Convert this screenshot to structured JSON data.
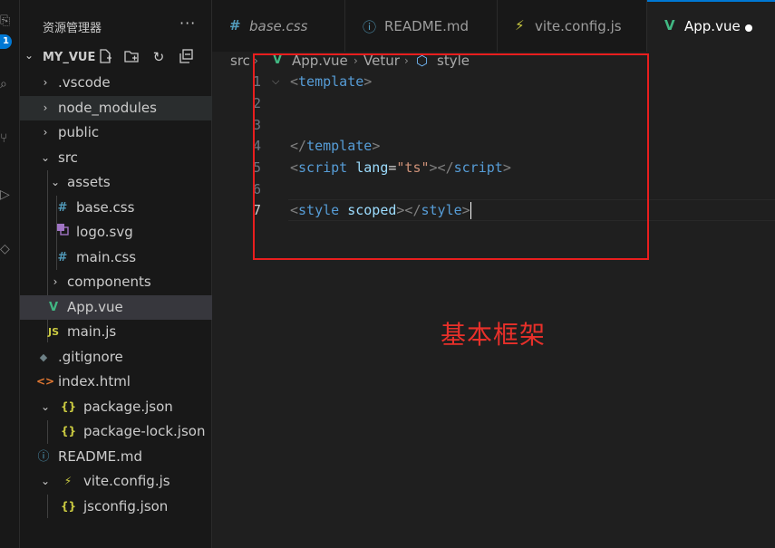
{
  "activity": {
    "badge": "1"
  },
  "sidebar": {
    "title": "资源管理器",
    "more": "···",
    "project": "MY_VUE",
    "tree": [
      {
        "label": ".vscode",
        "icon": "",
        "chevron": "›"
      },
      {
        "label": "node_modules",
        "icon": "",
        "chevron": "›"
      },
      {
        "label": "public",
        "icon": "",
        "chevron": "›"
      },
      {
        "label": "src",
        "icon": "",
        "chevron": "⌄"
      },
      {
        "label": "assets",
        "icon": "",
        "chevron": "⌄"
      },
      {
        "label": "base.css",
        "icon": "#",
        "chevron": ""
      },
      {
        "label": "logo.svg",
        "icon": "",
        "chevron": ""
      },
      {
        "label": "main.css",
        "icon": "#",
        "chevron": ""
      },
      {
        "label": "components",
        "icon": "",
        "chevron": "›"
      },
      {
        "label": "App.vue",
        "icon": "V",
        "chevron": ""
      },
      {
        "label": "main.js",
        "icon": "JS",
        "chevron": ""
      },
      {
        "label": ".gitignore",
        "icon": "◆",
        "chevron": ""
      },
      {
        "label": "index.html",
        "icon": "<>",
        "chevron": ""
      },
      {
        "label": "package.json",
        "icon": "{}",
        "chevron": "⌄"
      },
      {
        "label": "package-lock.json",
        "icon": "{}",
        "chevron": ""
      },
      {
        "label": "README.md",
        "icon": "ⓘ",
        "chevron": ""
      },
      {
        "label": "vite.config.js",
        "icon": "⚡",
        "chevron": "⌄"
      },
      {
        "label": "jsconfig.json",
        "icon": "{}",
        "chevron": ""
      }
    ]
  },
  "tabs": [
    {
      "label": "base.css",
      "icon": "#"
    },
    {
      "label": "README.md",
      "icon": "ⓘ"
    },
    {
      "label": "vite.config.js",
      "icon": "⚡"
    },
    {
      "label": "App.vue",
      "icon": "V"
    }
  ],
  "breadcrumb": [
    "src",
    "App.vue",
    "Vetur",
    "style"
  ],
  "editor": {
    "line_numbers": [
      "1",
      "2",
      "3",
      "4",
      "5",
      "6",
      "7"
    ],
    "lines": [
      {
        "b1": "<",
        "tag": "template",
        "b2": ">"
      },
      {},
      {},
      {
        "b1": "</",
        "tag": "template",
        "b2": ">"
      },
      {
        "b1": "<",
        "tag": "script",
        "sp": " ",
        "attr": "lang",
        "eq": "=",
        "str": "\"ts\"",
        "b2": "></",
        "tag2": "script",
        "b3": ">"
      },
      {},
      {
        "b1": "<",
        "tag": "style",
        "sp": " ",
        "attr": "scoped",
        "b2": "></",
        "tag2": "style",
        "b3": ">"
      }
    ]
  },
  "annotation": "基本框架",
  "colors": {
    "accent": "#0078d4",
    "vue": "#41b883",
    "css": "#519aba",
    "annotation": "#e8302a"
  }
}
